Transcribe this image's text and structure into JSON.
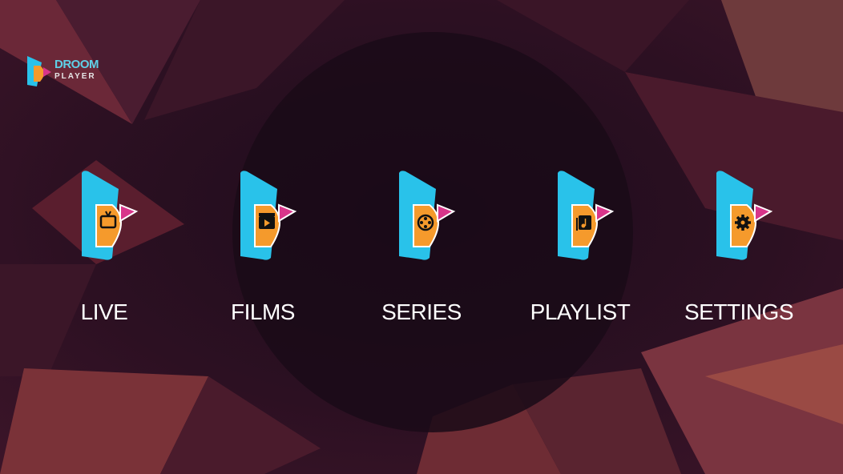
{
  "app": {
    "logo_line1": "DROOM",
    "logo_line2": "PLAYER"
  },
  "colors": {
    "background": "#2a0f22",
    "accent_cyan": "#29c2ea",
    "accent_orange": "#f59a2c",
    "accent_pink": "#d8358a",
    "text": "#ffffff"
  },
  "menu": {
    "items": [
      {
        "label": "LIVE",
        "icon": "tv-icon"
      },
      {
        "label": "FILMS",
        "icon": "clapperboard-icon"
      },
      {
        "label": "SERIES",
        "icon": "film-reel-icon"
      },
      {
        "label": "PLAYLIST",
        "icon": "music-playlist-icon"
      },
      {
        "label": "SETTINGS",
        "icon": "gear-icon"
      }
    ]
  }
}
